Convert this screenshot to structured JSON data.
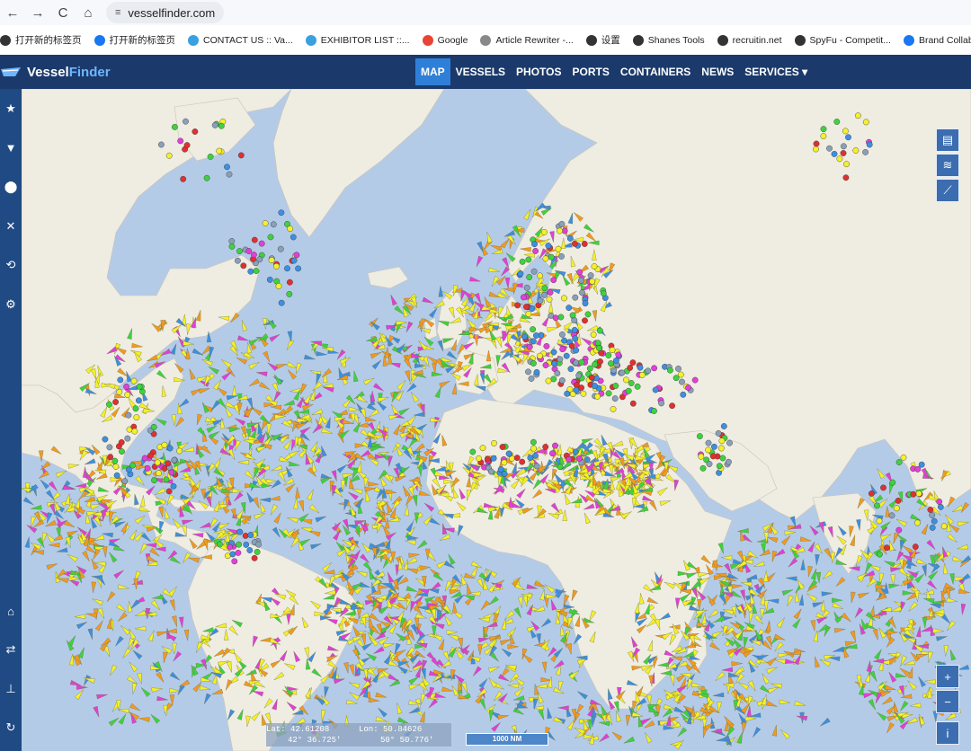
{
  "browser": {
    "back": "←",
    "forward": "→",
    "reload": "C",
    "home": "⌂",
    "url": "vesselfinder.com",
    "bookmarks": [
      {
        "label": "打开新的标签页",
        "color": "#333"
      },
      {
        "label": "打开新的标签页",
        "color": "#1877f2"
      },
      {
        "label": "CONTACT US :: Va...",
        "color": "#3aa0e0"
      },
      {
        "label": "EXHIBITOR LIST ::...",
        "color": "#3aa0e0"
      },
      {
        "label": "Google",
        "color": "#ea4335"
      },
      {
        "label": "Article Rewriter -...",
        "color": "#888"
      },
      {
        "label": "设置",
        "color": "#333"
      },
      {
        "label": "Shanes Tools",
        "color": "#333"
      },
      {
        "label": "recruitin.net",
        "color": "#333"
      },
      {
        "label": "SpyFu - Competit...",
        "color": "#333"
      },
      {
        "label": "Brand Collabs M",
        "color": "#1877f2"
      }
    ]
  },
  "site": {
    "logo_part1": "Vessel",
    "logo_part2": "Finder",
    "menu": [
      "MAP",
      "VESSELS",
      "PHOTOS",
      "PORTS",
      "CONTAINERS",
      "NEWS",
      "SERVICES ▾"
    ],
    "active_menu": "MAP",
    "left_icons_top": [
      "star-icon",
      "filter-icon",
      "location-pin-icon",
      "satellite-icon",
      "route-icon",
      "gear-icon"
    ],
    "left_icons_bottom": [
      "port-icon",
      "transfer-icon",
      "antenna-icon",
      "refresh-icon"
    ],
    "map_tools": [
      "map-layers-icon",
      "weather-icon",
      "distance-tool-icon"
    ],
    "zoom_in": "+",
    "zoom_out": "−",
    "info": "i",
    "coords": {
      "lat_label": "Lat:",
      "lat_decimal": "42.61208",
      "lat_dms": "42° 36.725'",
      "lon_label": "Lon:",
      "lon_decimal": "50.84626",
      "lon_dms": "50° 50.776'"
    },
    "scale_label": "1000 NM"
  },
  "colors": {
    "header": "#1b3a6b",
    "menu_active": "#2f7fd9",
    "sea": "#b4cbe8",
    "land": "#efece2",
    "vessel_yellow": "#f4f02a",
    "vessel_orange": "#f29a1e",
    "vessel_blue": "#3d8fe0",
    "vessel_green": "#3ed23e",
    "vessel_magenta": "#e23fd8",
    "vessel_red": "#e03030",
    "vessel_grey": "#8aa0b8"
  }
}
